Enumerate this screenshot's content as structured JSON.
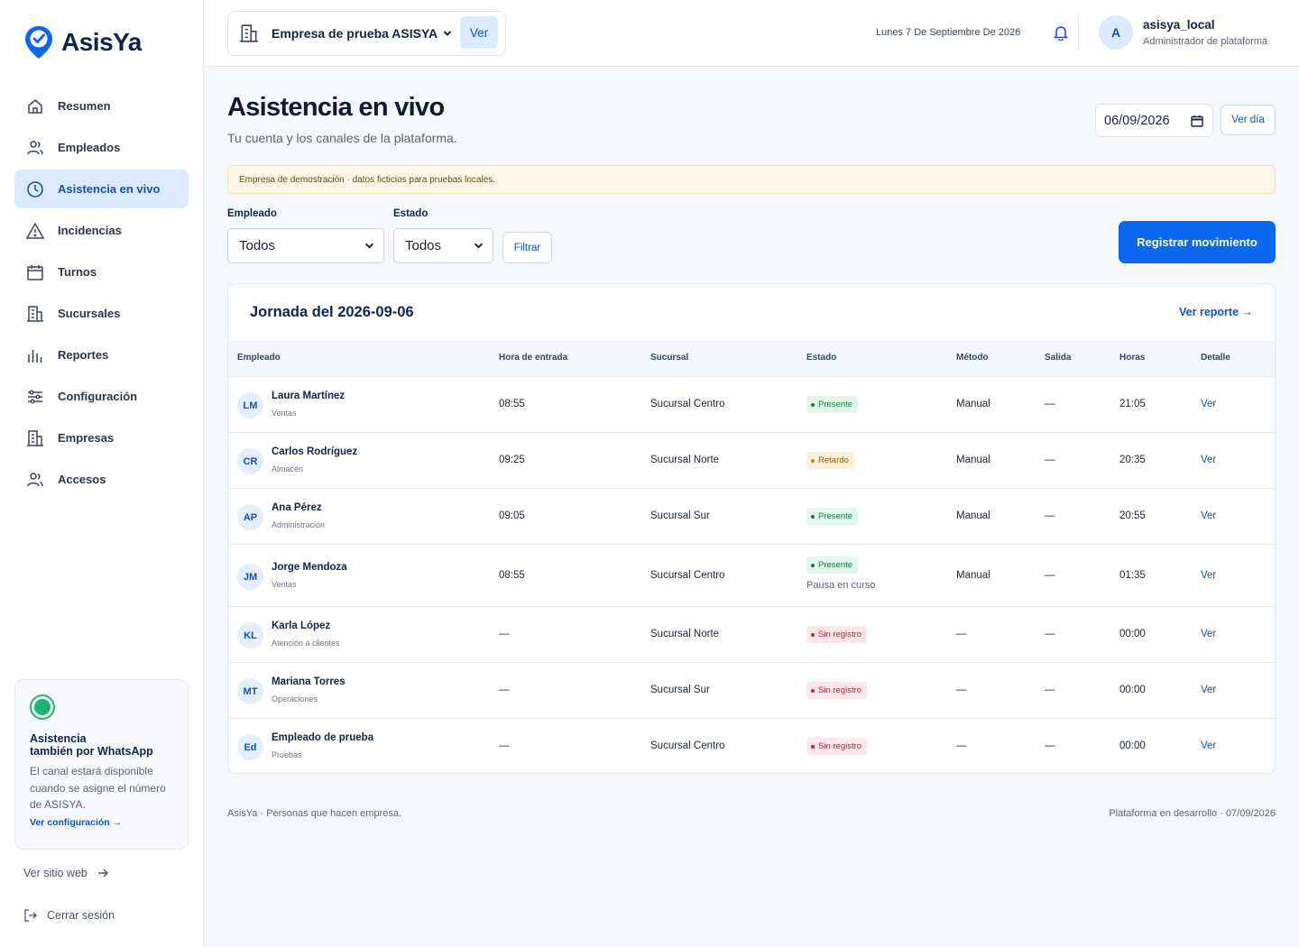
{
  "brand": {
    "name": "AsisYa"
  },
  "sidebar": {
    "items": [
      {
        "label": "Resumen",
        "icon": "home-icon"
      },
      {
        "label": "Empleados",
        "icon": "users-icon"
      },
      {
        "label": "Asistencia en vivo",
        "icon": "clock-icon",
        "active": true
      },
      {
        "label": "Incidencias",
        "icon": "alert-triangle-icon"
      },
      {
        "label": "Turnos",
        "icon": "calendar-icon"
      },
      {
        "label": "Sucursales",
        "icon": "building-icon"
      },
      {
        "label": "Reportes",
        "icon": "bar-chart-icon"
      },
      {
        "label": "Configuración",
        "icon": "sliders-icon"
      },
      {
        "label": "Empresas",
        "icon": "building-icon"
      },
      {
        "label": "Accesos",
        "icon": "users-icon"
      }
    ],
    "whatsapp": {
      "title_line1": "Asistencia",
      "title_line2": "también por WhatsApp",
      "text": "El canal estará disponible cuando se asigne el número de ASISYA.",
      "link": "Ver configuración →"
    },
    "site_link": "Ver sitio web",
    "logout": "Cerrar sesión"
  },
  "header": {
    "company": "Empresa de prueba ASISYA",
    "ver": "Ver",
    "date": "Lunes 7 De Septiembre De 2026",
    "user": {
      "initial": "A",
      "name": "asisya_local",
      "role": "Administrador de plataforma"
    }
  },
  "main": {
    "title": "Asistencia en vivo",
    "subtitle": "Tu cuenta y los canales de la plataforma.",
    "date_value": "06/09/2026",
    "ver_dia": "Ver día",
    "notice": "Empresa de demostración · datos ficticios para pruebas locales.",
    "filters": {
      "empleado_label": "Empleado",
      "empleado_value": "Todos",
      "estado_label": "Estado",
      "estado_value": "Todos",
      "filtrar": "Filtrar"
    },
    "primary_button": "Registrar movimiento"
  },
  "table": {
    "title": "Jornada del 2026-09-06",
    "report_link": "Ver reporte →",
    "headers": [
      "Empleado",
      "Hora de entrada",
      "Sucursal",
      "Estado",
      "Método",
      "Salida",
      "Horas",
      "Detalle"
    ],
    "rows": [
      {
        "initials": "LM",
        "name": "Laura Martínez",
        "dept": "Ventas",
        "entrada": "08:55",
        "sucursal": "Sucursal Centro",
        "estado": "Presente",
        "estado_kind": "green",
        "note": "",
        "metodo": "Manual",
        "salida": "—",
        "horas": "21:05",
        "detalle": "Ver"
      },
      {
        "initials": "CR",
        "name": "Carlos Rodríguez",
        "dept": "Almacén",
        "entrada": "09:25",
        "sucursal": "Sucursal Norte",
        "estado": "Retardo",
        "estado_kind": "amber",
        "note": "",
        "metodo": "Manual",
        "salida": "—",
        "horas": "20:35",
        "detalle": "Ver"
      },
      {
        "initials": "AP",
        "name": "Ana Pérez",
        "dept": "Administración",
        "entrada": "09:05",
        "sucursal": "Sucursal Sur",
        "estado": "Presente",
        "estado_kind": "green",
        "note": "",
        "metodo": "Manual",
        "salida": "—",
        "horas": "20:55",
        "detalle": "Ver"
      },
      {
        "initials": "JM",
        "name": "Jorge Mendoza",
        "dept": "Ventas",
        "entrada": "08:55",
        "sucursal": "Sucursal Centro",
        "estado": "Presente",
        "estado_kind": "green",
        "note": "Pausa en curso",
        "metodo": "Manual",
        "salida": "—",
        "horas": "01:35",
        "detalle": "Ver"
      },
      {
        "initials": "KL",
        "name": "Karla López",
        "dept": "Atención a clientes",
        "entrada": "—",
        "sucursal": "Sucursal Norte",
        "estado": "Sin registro",
        "estado_kind": "red",
        "note": "",
        "metodo": "—",
        "salida": "—",
        "horas": "00:00",
        "detalle": "Ver"
      },
      {
        "initials": "MT",
        "name": "Mariana Torres",
        "dept": "Operaciones",
        "entrada": "—",
        "sucursal": "Sucursal Sur",
        "estado": "Sin registro",
        "estado_kind": "red",
        "note": "",
        "metodo": "—",
        "salida": "—",
        "horas": "00:00",
        "detalle": "Ver"
      },
      {
        "initials": "Ed",
        "name": "Empleado de prueba",
        "dept": "Pruebas",
        "entrada": "—",
        "sucursal": "Sucursal Centro",
        "estado": "Sin registro",
        "estado_kind": "red",
        "note": "",
        "metodo": "—",
        "salida": "—",
        "horas": "00:00",
        "detalle": "Ver"
      }
    ]
  },
  "footer": {
    "left": "AsisYa · Personas que hacen empresa.",
    "right": "Plataforma en desarrollo · 07/09/2026"
  },
  "colors": {
    "accent": "#0b66f0",
    "active_bg": "#dbeafe",
    "present": "#147a45",
    "late": "#c9820c",
    "missing": "#bf2338"
  }
}
